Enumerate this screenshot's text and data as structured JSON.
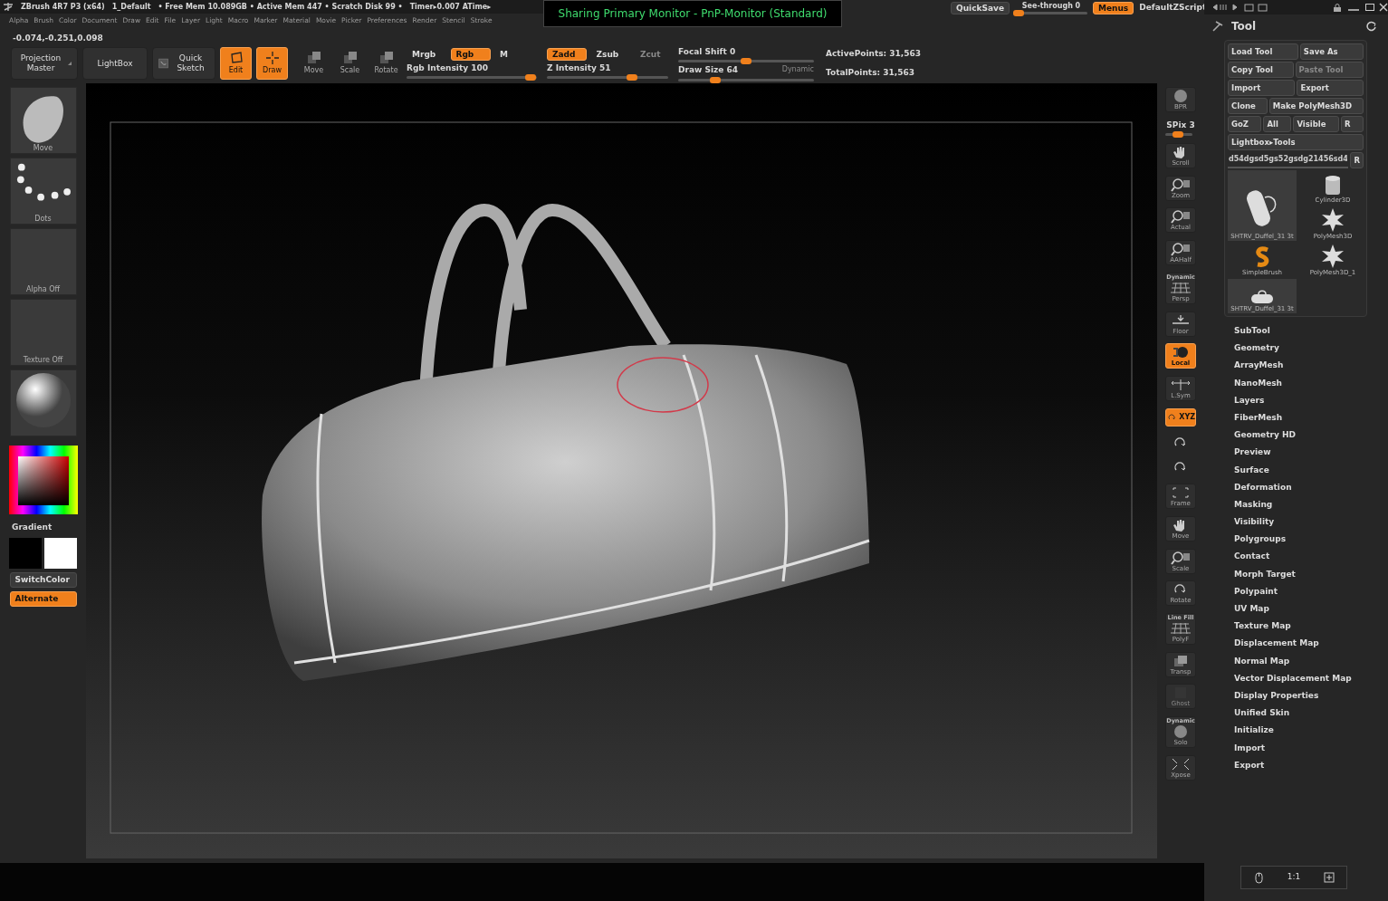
{
  "title_bar": {
    "app": "ZBrush 4R7 P3 (x64)",
    "document": "1_Default",
    "status": "• Free Mem 10.089GB • Active Mem 447 • Scratch Disk 99 •",
    "timer": "Timer▸0.007 ATime▸"
  },
  "notice": "Sharing Primary Monitor - PnP-Monitor (Standard)",
  "top_controls": {
    "quicksave": "QuickSave",
    "see_through": {
      "label": "See-through",
      "value": "0",
      "level": 0.05
    },
    "menus": {
      "label": "Menus",
      "on": true
    },
    "script": "DefaultZScript"
  },
  "menu_bar": [
    "Alpha",
    "Brush",
    "Color",
    "Document",
    "Draw",
    "Edit",
    "File",
    "Layer",
    "Light",
    "Macro",
    "Marker",
    "Material",
    "Movie",
    "Picker",
    "Preferences",
    "Render",
    "Stencil",
    "Stroke"
  ],
  "coordinates": "-0.074,-0.251,0.098",
  "toolbar": {
    "shelf_buttons": [
      {
        "label": "Projection Master",
        "kind": "menu"
      },
      {
        "label": "LightBox",
        "kind": "plain"
      },
      {
        "label": "Quick Sketch",
        "kind": "sketch"
      }
    ],
    "modes": [
      {
        "label": "Edit",
        "kind": "edit",
        "on": true
      },
      {
        "label": "Draw",
        "kind": "draw",
        "on": true
      },
      {
        "label": "Move",
        "kind": "move",
        "on": false
      },
      {
        "label": "Scale",
        "kind": "scale",
        "on": false
      },
      {
        "label": "Rotate",
        "kind": "rotate",
        "on": false
      }
    ],
    "color_modes": [
      {
        "label": "Mrgb",
        "on": false
      },
      {
        "label": "Rgb",
        "on": true
      },
      {
        "label": "M",
        "on": false
      }
    ],
    "rgb_intensity": {
      "label": "Rgb Intensity",
      "value": "100",
      "level": 0.95
    },
    "z_modes": [
      {
        "label": "Zadd",
        "on": true,
        "disabled": false
      },
      {
        "label": "Zsub",
        "on": false,
        "disabled": false
      },
      {
        "label": "Zcut",
        "on": false,
        "disabled": true
      }
    ],
    "z_intensity": {
      "label": "Z Intensity",
      "value": "51",
      "level": 0.7
    },
    "focal_shift": {
      "label": "Focal Shift",
      "value": "0",
      "level": 0.5
    },
    "draw_size": {
      "label": "Draw Size",
      "value": "64",
      "level": 0.27
    },
    "dynamic": {
      "label": "Dynamic",
      "disabled": true
    },
    "points": [
      "ActivePoints: 31,563",
      "TotalPoints: 31,563"
    ]
  },
  "left_shelf": {
    "thumbnails": [
      {
        "kind": "brush",
        "label": "Move"
      },
      {
        "kind": "stroke",
        "label": "Dots"
      },
      {
        "kind": "alpha",
        "label": "Alpha Off"
      },
      {
        "kind": "texture",
        "label": "Texture Off"
      },
      {
        "kind": "material"
      }
    ],
    "gradient": "Gradient",
    "switch_color": "SwitchColor",
    "alternate": {
      "label": "Alternate",
      "on": true
    }
  },
  "side_strip": [
    {
      "kind": "bpr",
      "label": "BPR",
      "on": false,
      "disabled": false
    },
    {
      "kind": "slider",
      "label": "SPix 3",
      "level": 0.45
    },
    {
      "kind": "scroll",
      "label": "Scroll",
      "on": false,
      "disabled": false
    },
    {
      "kind": "zoom",
      "label": "Zoom",
      "on": false,
      "disabled": false
    },
    {
      "kind": "actual",
      "label": "Actual",
      "on": false,
      "disabled": false
    },
    {
      "kind": "aahalf",
      "label": "AAHalf",
      "on": false,
      "disabled": false
    },
    {
      "kind": "persp",
      "caption": "Dynamic",
      "label": "Persp",
      "on": false,
      "disabled": false
    },
    {
      "kind": "floor",
      "label": "Floor",
      "on": false,
      "disabled": false
    },
    {
      "kind": "local",
      "label": "Local",
      "on": true,
      "disabled": false
    },
    {
      "kind": "lsym",
      "label": "L.Sym",
      "on": false,
      "disabled": false
    },
    {
      "kind": "xyz",
      "label": "XYZ",
      "on": true,
      "disabled": false
    },
    {
      "kind": "axis",
      "on": false,
      "disabled": false
    },
    {
      "kind": "axis",
      "on": false,
      "disabled": false
    },
    {
      "kind": "frame",
      "label": "Frame",
      "on": false,
      "disabled": false
    },
    {
      "kind": "move",
      "label": "Move",
      "on": false,
      "disabled": false
    },
    {
      "kind": "scale",
      "label": "Scale",
      "on": false,
      "disabled": false
    },
    {
      "kind": "rotate",
      "label": "Rotate",
      "on": false,
      "disabled": false
    },
    {
      "kind": "polyf",
      "caption": "Line Fill",
      "label": "PolyF",
      "on": false,
      "disabled": false
    },
    {
      "kind": "transp",
      "label": "Transp",
      "on": false,
      "disabled": false
    },
    {
      "kind": "ghost",
      "label": "Ghost",
      "on": false,
      "disabled": true
    },
    {
      "kind": "solo",
      "caption": "Dynamic",
      "label": "Solo",
      "on": false,
      "disabled": false
    },
    {
      "kind": "xpose",
      "label": "Xpose",
      "on": false,
      "disabled": false
    }
  ],
  "tool_palette": {
    "title": "Tool",
    "button_rows": [
      [
        {
          "label": "Load Tool",
          "disabled": false
        },
        {
          "label": "Save As",
          "disabled": false
        }
      ],
      [
        {
          "label": "Copy Tool",
          "disabled": false
        },
        {
          "label": "Paste Tool",
          "disabled": true
        }
      ],
      [
        {
          "label": "Import",
          "disabled": false
        },
        {
          "label": "Export",
          "disabled": false
        }
      ],
      [
        {
          "label": "Clone",
          "disabled": false
        },
        {
          "label": "Make PolyMesh3D",
          "disabled": false
        }
      ],
      [
        {
          "label": "GoZ",
          "disabled": false
        },
        {
          "label": "All",
          "disabled": false
        },
        {
          "label": "Visible",
          "disabled": false
        },
        {
          "label": "R",
          "disabled": false
        }
      ],
      [
        {
          "label": "Lightbox▸Tools",
          "disabled": false
        }
      ]
    ],
    "name_field": "d54dgsd5gs52gsdg21456sd4",
    "name_reset": "R",
    "tools": [
      {
        "kind": "cylinder",
        "label": "Cylinder3D",
        "selected": false
      },
      {
        "kind": "duffel",
        "label": "SHTRV_Duffel_31 3t",
        "selected": true
      },
      {
        "kind": "star",
        "label": "PolyMesh3D",
        "selected": false
      },
      {
        "kind": "brush",
        "label": "SimpleBrush",
        "selected": false
      },
      {
        "kind": "star",
        "label": "PolyMesh3D_1",
        "selected": false
      },
      {
        "kind": "duffel",
        "label": "SHTRV_Duffel_31 3t",
        "selected": false
      }
    ],
    "sections": [
      "SubTool",
      "Geometry",
      "ArrayMesh",
      "NanoMesh",
      "Layers",
      "FiberMesh",
      "Geometry HD",
      "Preview",
      "Surface",
      "Deformation",
      "Masking",
      "Visibility",
      "Polygroups",
      "Contact",
      "Morph Target",
      "Polypaint",
      "UV Map",
      "Texture Map",
      "Displacement Map",
      "Normal Map",
      "Vector Displacement Map",
      "Display Properties",
      "Unified Skin",
      "Initialize",
      "Import",
      "Export"
    ]
  },
  "zoom_widget": {
    "ratio": "1:1"
  }
}
